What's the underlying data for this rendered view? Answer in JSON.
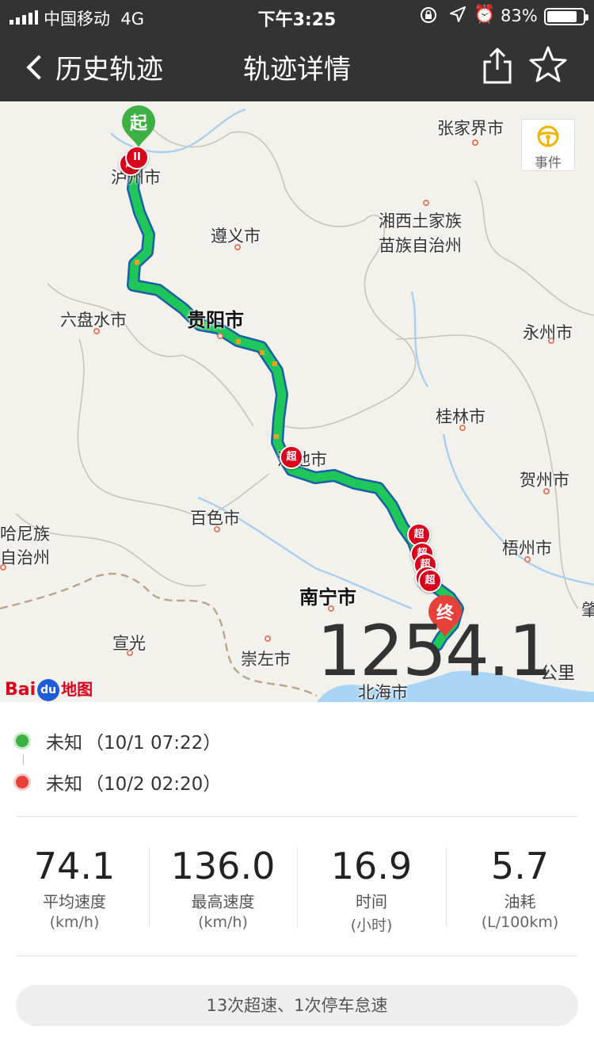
{
  "status_bar": {
    "carrier": "中国移动",
    "network": "4G",
    "time": "下午3:25",
    "battery_percent": "83%",
    "battery_level": 0.83
  },
  "nav": {
    "back_label": "历史轨迹",
    "title": "轨迹详情"
  },
  "map": {
    "event_button_label": "事件",
    "start_pin_label": "起",
    "end_pin_label": "终",
    "overspeed_marker_label": "超",
    "brand": "Bai",
    "brand_du": "du",
    "brand_map": "地图",
    "cities": {
      "zhangjiajie": "张家界市",
      "xiangxi_1": "湘西土家族",
      "xiangxi_2": "苗族自治州",
      "zunyi": "遵义市",
      "luzhou": "泸州市",
      "liupanshui": "六盘水市",
      "guiyang": "贵阳市",
      "yongzhou": "永州市",
      "guilin": "桂林市",
      "hechi": "河池市",
      "hezhou": "贺州市",
      "baise": "百色市",
      "wuzhou": "梧州市",
      "hani_1": "哈尼族",
      "hani_2": "自治州",
      "nanning": "南宁市",
      "xuanguang": "宣光",
      "chongzuo": "崇左市",
      "beihai": "北海市",
      "zhao": "肇"
    },
    "distance_value": "1254.1",
    "distance_unit": "公里"
  },
  "trip": {
    "start_place": "未知",
    "start_time": "（10/1 07:22）",
    "end_place": "未知",
    "end_time": "（10/2 02:20）"
  },
  "stats": [
    {
      "value": "74.1",
      "name": "平均速度",
      "unit": "(km/h)"
    },
    {
      "value": "136.0",
      "name": "最高速度",
      "unit": "(km/h)"
    },
    {
      "value": "16.9",
      "name": "时间",
      "unit": "(小时)"
    },
    {
      "value": "5.7",
      "name": "油耗",
      "unit": "(L/100km)"
    }
  ],
  "summary": "13次超速、1次停车怠速",
  "colors": {
    "topbar": "#333333",
    "route": "#1fc65a",
    "route_outline": "#1a5fa8",
    "start": "#3cb043",
    "end": "#e8413a",
    "overspeed": "#d8001c"
  }
}
